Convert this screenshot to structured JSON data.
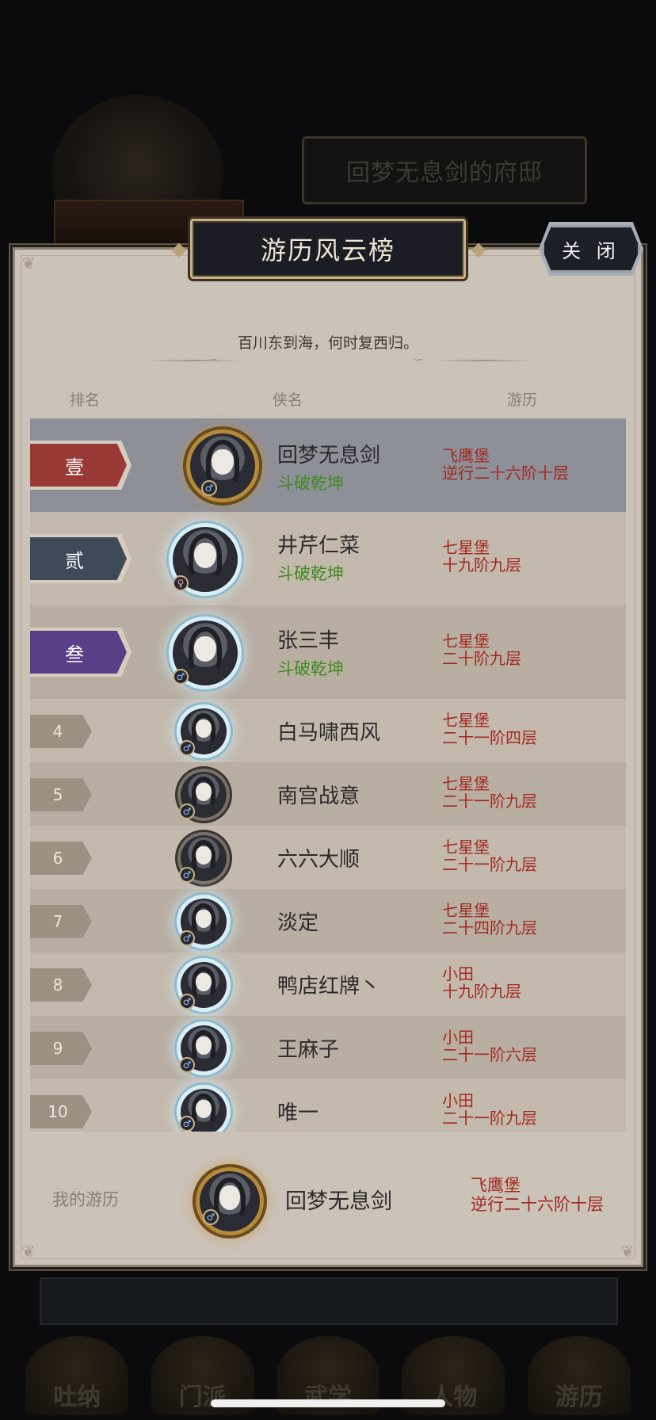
{
  "background": {
    "mansion_label": "回梦无息剑的府邸",
    "tabs": [
      "吐纳",
      "门派",
      "武学",
      "人物",
      "游历"
    ]
  },
  "panel": {
    "title": "游历风云榜",
    "close_label": "关 闭",
    "motto": "百川东到海，何时复西归。",
    "columns": {
      "rank": "排名",
      "name": "侠名",
      "travel": "游历"
    }
  },
  "rankings": [
    {
      "rank": "壹",
      "name": "回梦无息剑",
      "sect": "斗破乾坤",
      "location": "飞鹰堡",
      "progress": "逆行二十六阶十层",
      "gender": "male",
      "frame": "gold",
      "badge_color": "#9a3a36"
    },
    {
      "rank": "贰",
      "name": "井芹仁菜",
      "sect": "斗破乾坤",
      "location": "七星堡",
      "progress": "十九阶九层",
      "gender": "female",
      "frame": "ice",
      "badge_color": "#3d4a58"
    },
    {
      "rank": "叁",
      "name": "张三丰",
      "sect": "斗破乾坤",
      "location": "七星堡",
      "progress": "二十阶九层",
      "gender": "male",
      "frame": "ice",
      "badge_color": "#5b3f86"
    },
    {
      "rank": "4",
      "name": "白马啸西风",
      "location": "七星堡",
      "progress": "二十一阶四层",
      "gender": "male",
      "frame": "ice"
    },
    {
      "rank": "5",
      "name": "南宫战意",
      "location": "七星堡",
      "progress": "二十一阶九层",
      "gender": "male",
      "frame": "dark"
    },
    {
      "rank": "6",
      "name": "六六大顺",
      "location": "七星堡",
      "progress": "二十一阶九层",
      "gender": "male",
      "frame": "dark"
    },
    {
      "rank": "7",
      "name": "淡定",
      "location": "七星堡",
      "progress": "二十四阶九层",
      "gender": "male",
      "frame": "ice"
    },
    {
      "rank": "8",
      "name": "鸭店红牌丶",
      "location": "小田",
      "progress": "十九阶九层",
      "gender": "male",
      "frame": "ice"
    },
    {
      "rank": "9",
      "name": "王麻子",
      "location": "小田",
      "progress": "二十一阶六层",
      "gender": "male",
      "frame": "ice"
    },
    {
      "rank": "10",
      "name": "唯一",
      "location": "小田",
      "progress": "二十一阶九层",
      "gender": "male",
      "frame": "ice"
    }
  ],
  "my_record": {
    "label": "我的游历",
    "name": "回梦无息剑",
    "location": "飞鹰堡",
    "progress": "逆行二十六阶十层",
    "gender": "male",
    "frame": "gold"
  }
}
